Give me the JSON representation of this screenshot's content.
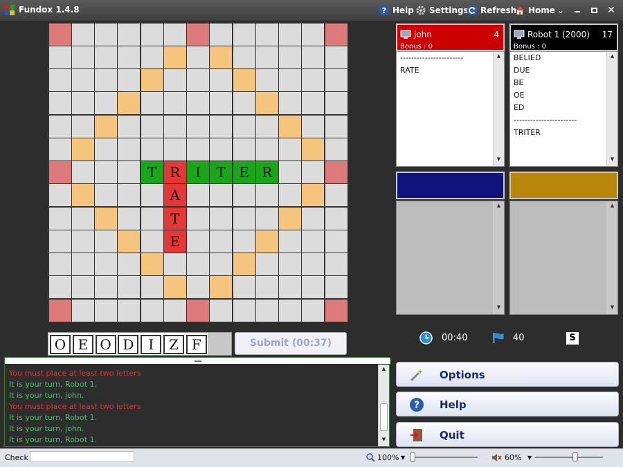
{
  "app": {
    "title": "Fundox 1.4.8"
  },
  "toolbar": {
    "help": "Help",
    "settings": "Settings",
    "refresh": "Refresh",
    "home": "Home",
    "colors": {
      "help_icon": "#2a5db0",
      "refresh_icon": "#2a5db0",
      "home_icon": "#e24a3a"
    }
  },
  "board": {
    "size": 13,
    "double_squares": [
      [
        1,
        5
      ],
      [
        1,
        7
      ],
      [
        2,
        4
      ],
      [
        2,
        8
      ],
      [
        3,
        3
      ],
      [
        3,
        9
      ],
      [
        4,
        2
      ],
      [
        4,
        10
      ],
      [
        5,
        1
      ],
      [
        5,
        11
      ],
      [
        7,
        1
      ],
      [
        7,
        11
      ],
      [
        8,
        2
      ],
      [
        8,
        10
      ],
      [
        9,
        3
      ],
      [
        9,
        9
      ],
      [
        10,
        4
      ],
      [
        10,
        8
      ],
      [
        11,
        5
      ],
      [
        11,
        7
      ]
    ],
    "triple_squares": [
      [
        0,
        0
      ],
      [
        0,
        6
      ],
      [
        0,
        12
      ],
      [
        6,
        0
      ],
      [
        6,
        12
      ],
      [
        12,
        0
      ],
      [
        12,
        6
      ],
      [
        12,
        12
      ]
    ],
    "tiles": [
      {
        "row": 6,
        "col": 4,
        "letter": "T",
        "color": "green"
      },
      {
        "row": 6,
        "col": 5,
        "letter": "R",
        "color": "red"
      },
      {
        "row": 6,
        "col": 6,
        "letter": "I",
        "color": "green"
      },
      {
        "row": 6,
        "col": 7,
        "letter": "T",
        "color": "green"
      },
      {
        "row": 6,
        "col": 8,
        "letter": "E",
        "color": "green"
      },
      {
        "row": 6,
        "col": 9,
        "letter": "R",
        "color": "green"
      },
      {
        "row": 7,
        "col": 5,
        "letter": "A",
        "color": "red"
      },
      {
        "row": 8,
        "col": 5,
        "letter": "T",
        "color": "red"
      },
      {
        "row": 9,
        "col": 5,
        "letter": "E",
        "color": "red"
      }
    ],
    "colors": {
      "empty": "#dcdcdc",
      "double": "#f5c57e",
      "triple": "#dd7a7a",
      "green_tile": "#19a619",
      "red_tile": "#e63737"
    }
  },
  "rack": {
    "letters": [
      "O",
      "E",
      "O",
      "D",
      "I",
      "Z",
      "F"
    ]
  },
  "submit": {
    "label": "Submit (00:37)"
  },
  "players": [
    {
      "name": "john",
      "score": "4",
      "bonus": "Bonus : 0",
      "color": "#cc0000",
      "words": [
        "-----------------------",
        "RATE"
      ]
    },
    {
      "name": "Robot 1   (2000)",
      "score": "17",
      "bonus": "Bonus : 0",
      "color": "#000000",
      "words": [
        "BELIED",
        "DUE",
        "BE",
        "OE",
        "ED",
        "-----------------------",
        "TRITER"
      ]
    }
  ],
  "empty_panels": [
    {
      "color": "#10147a"
    },
    {
      "color": "#b8860b"
    }
  ],
  "timer": {
    "clock": "00:40",
    "remaining": "40",
    "s_badge": "S"
  },
  "chat": {
    "messages": [
      {
        "text": "You must place at least two letters",
        "color": "#e53030"
      },
      {
        "text": "It is your turn, Robot 1.",
        "color": "#3fc46a"
      },
      {
        "text": "It is your turn, john.",
        "color": "#3fc46a"
      },
      {
        "text": "You must place at least two letters",
        "color": "#e53030"
      },
      {
        "text": "It is your turn, Robot 1.",
        "color": "#3fc46a"
      },
      {
        "text": "It is your turn, john.",
        "color": "#3fc46a"
      },
      {
        "text": "It is your turn, Robot 1.",
        "color": "#3fc46a"
      }
    ]
  },
  "actions": {
    "options": "Options",
    "help": "Help",
    "quit": "Quit"
  },
  "status": {
    "check_label": "Check",
    "zoom": "100%",
    "volume": "60%",
    "zoom_level": 0.0,
    "volume_level": 0.6
  }
}
